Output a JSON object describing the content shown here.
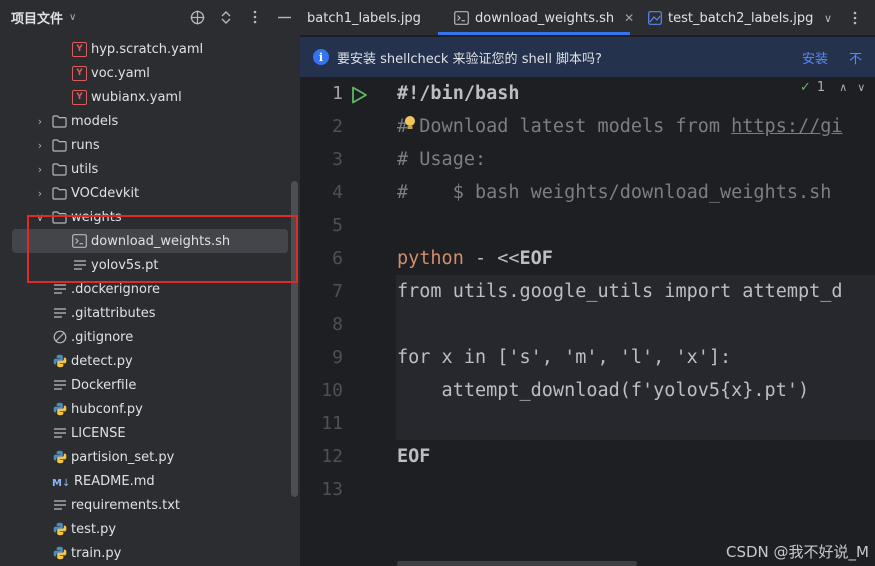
{
  "project_panel": {
    "title": "项目文件",
    "tools": [
      "crosshair-icon",
      "expand-collapse-icon",
      "more-icon",
      "minimize-icon"
    ],
    "items": [
      {
        "label": "hyp.scratch.yaml",
        "type": "yaml",
        "level": 3
      },
      {
        "label": "voc.yaml",
        "type": "yaml",
        "level": 3
      },
      {
        "label": "wubianx.yaml",
        "type": "yaml",
        "level": 3
      },
      {
        "label": "models",
        "type": "folder",
        "level": 2,
        "expanded": false
      },
      {
        "label": "runs",
        "type": "folder",
        "level": 2,
        "expanded": false
      },
      {
        "label": "utils",
        "type": "folder",
        "level": 2,
        "expanded": false
      },
      {
        "label": "VOCdevkit",
        "type": "folder",
        "level": 2,
        "expanded": false
      },
      {
        "label": "weights",
        "type": "folder",
        "level": 2,
        "expanded": true
      },
      {
        "label": "download_weights.sh",
        "type": "shell",
        "level": 3,
        "selected": true
      },
      {
        "label": "yolov5s.pt",
        "type": "text",
        "level": 3
      },
      {
        "label": ".dockerignore",
        "type": "text",
        "level": 2
      },
      {
        "label": ".gitattributes",
        "type": "text",
        "level": 2
      },
      {
        "label": ".gitignore",
        "type": "git",
        "level": 2
      },
      {
        "label": "detect.py",
        "type": "python",
        "level": 2
      },
      {
        "label": "Dockerfile",
        "type": "text",
        "level": 2
      },
      {
        "label": "hubconf.py",
        "type": "python",
        "level": 2
      },
      {
        "label": "LICENSE",
        "type": "text",
        "level": 2
      },
      {
        "label": "partision_set.py",
        "type": "python",
        "level": 2
      },
      {
        "label": "README.md",
        "type": "markdown",
        "level": 2
      },
      {
        "label": "requirements.txt",
        "type": "text",
        "level": 2
      },
      {
        "label": "test.py",
        "type": "python",
        "level": 2
      },
      {
        "label": "train.py",
        "type": "python",
        "level": 2
      }
    ]
  },
  "tabs": [
    {
      "label": "batch1_labels.jpg",
      "active": false,
      "partial": true
    },
    {
      "label": "download_weights.sh",
      "active": true
    },
    {
      "label": "test_batch2_labels.jpg",
      "active": false
    }
  ],
  "banner": {
    "message": "要安装 shellcheck 来验证您的 shell 脚本吗?",
    "install_label": "安装",
    "dismiss_label": "不"
  },
  "inspection": {
    "count": "1"
  },
  "editor": {
    "current_line": 1,
    "lines": [
      {
        "n": "1",
        "text": "#!/bin/bash"
      },
      {
        "n": "2",
        "text": "# Download latest models from https://gi"
      },
      {
        "n": "3",
        "text": "# Usage:"
      },
      {
        "n": "4",
        "text": "#    $ bash weights/download_weights.sh"
      },
      {
        "n": "5",
        "text": ""
      },
      {
        "n": "6",
        "text": "python - <<EOF"
      },
      {
        "n": "7",
        "text": "from utils.google_utils import attempt_d"
      },
      {
        "n": "8",
        "text": ""
      },
      {
        "n": "9",
        "text": "for x in ['s', 'm', 'l', 'x']:"
      },
      {
        "n": "10",
        "text": "    attempt_download(f'yolov5{x}.pt')"
      },
      {
        "n": "11",
        "text": ""
      },
      {
        "n": "12",
        "text": "EOF"
      },
      {
        "n": "13",
        "text": ""
      }
    ]
  },
  "watermark": "CSDN @我不好说_M",
  "colors": {
    "accent": "#3574f0",
    "highlight_box": "#e02a2a",
    "keyword": "#cf8e6d",
    "comment": "#7a7e85",
    "string": "#6aab73"
  }
}
